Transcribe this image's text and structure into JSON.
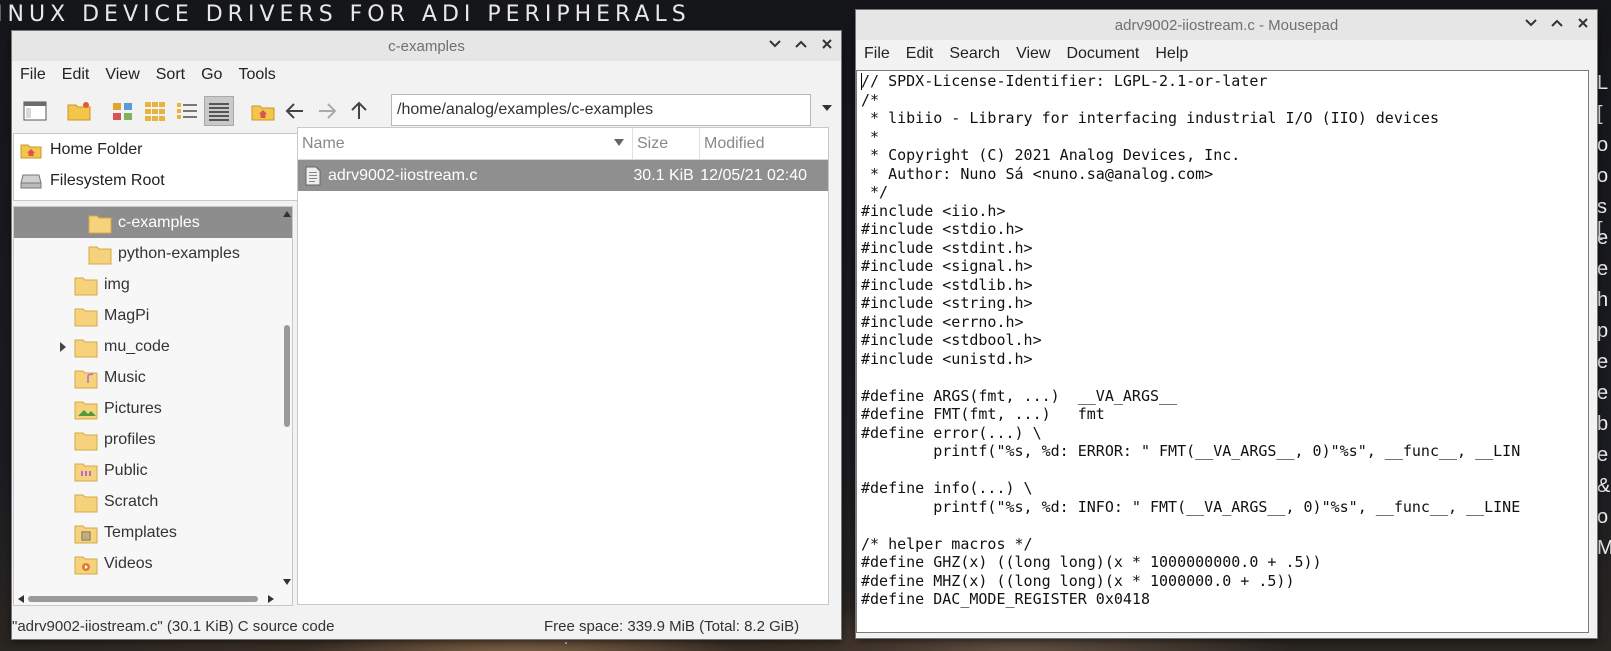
{
  "desktop": {
    "banner": "INUX DEVICE DRIVERS FOR ADI PERIPHERALS",
    "right_edge_chars": [
      "L",
      "[",
      "o",
      "o",
      "s [",
      "e",
      "e",
      "h",
      "p",
      "e",
      "e",
      "b",
      "e",
      "&",
      "o",
      "M"
    ]
  },
  "file_manager": {
    "title": "c-examples",
    "menu": [
      "File",
      "Edit",
      "View",
      "Sort",
      "Go",
      "Tools"
    ],
    "path": "/home/analog/examples/c-examples",
    "places": [
      {
        "label": "Home Folder",
        "icon": "home-icon"
      },
      {
        "label": "Filesystem Root",
        "icon": "drive-icon"
      }
    ],
    "tree": [
      {
        "label": "c-examples",
        "indent": 2,
        "selected": true,
        "icon": "folder-icon"
      },
      {
        "label": "python-examples",
        "indent": 2,
        "selected": false,
        "icon": "folder-icon"
      },
      {
        "label": "img",
        "indent": 1,
        "selected": false,
        "icon": "folder-icon"
      },
      {
        "label": "MagPi",
        "indent": 1,
        "selected": false,
        "icon": "folder-icon"
      },
      {
        "label": "mu_code",
        "indent": 1,
        "selected": false,
        "expander": true,
        "icon": "folder-icon"
      },
      {
        "label": "Music",
        "indent": 1,
        "selected": false,
        "icon": "music-folder-icon"
      },
      {
        "label": "Pictures",
        "indent": 1,
        "selected": false,
        "icon": "pictures-folder-icon"
      },
      {
        "label": "profiles",
        "indent": 1,
        "selected": false,
        "icon": "folder-icon"
      },
      {
        "label": "Public",
        "indent": 1,
        "selected": false,
        "icon": "public-folder-icon"
      },
      {
        "label": "Scratch",
        "indent": 1,
        "selected": false,
        "icon": "folder-icon"
      },
      {
        "label": "Templates",
        "indent": 1,
        "selected": false,
        "icon": "templates-folder-icon"
      },
      {
        "label": "Videos",
        "indent": 1,
        "selected": false,
        "icon": "videos-folder-icon"
      }
    ],
    "columns": {
      "name": "Name",
      "size": "Size",
      "modified": "Modified"
    },
    "files": [
      {
        "name": "adrv9002-iiostream.c",
        "size": "30.1 KiB",
        "modified": "12/05/21 02:40"
      }
    ],
    "status_left": "\"adrv9002-iiostream.c\" (30.1 KiB) C source code",
    "status_right": "Free space: 339.9 MiB (Total: 8.2 GiB)"
  },
  "mousepad": {
    "title": "adrv9002-iiostream.c - Mousepad",
    "menu": [
      "File",
      "Edit",
      "Search",
      "View",
      "Document",
      "Help"
    ],
    "lines": [
      "// SPDX-License-Identifier: LGPL-2.1-or-later",
      "/*",
      " * libiio - Library for interfacing industrial I/O (IIO) devices",
      " *",
      " * Copyright (C) 2021 Analog Devices, Inc.",
      " * Author: Nuno Sá <nuno.sa@analog.com>",
      " */",
      "#include <iio.h>",
      "#include <stdio.h>",
      "#include <stdint.h>",
      "#include <signal.h>",
      "#include <stdlib.h>",
      "#include <string.h>",
      "#include <errno.h>",
      "#include <stdbool.h>",
      "#include <unistd.h>",
      "",
      "#define ARGS(fmt, ...)  __VA_ARGS__",
      "#define FMT(fmt, ...)   fmt",
      "#define error(...) \\",
      "        printf(\"%s, %d: ERROR: \" FMT(__VA_ARGS__, 0)\"%s\", __func__, __LIN",
      "",
      "#define info(...) \\",
      "        printf(\"%s, %d: INFO: \" FMT(__VA_ARGS__, 0)\"%s\", __func__, __LINE",
      "",
      "/* helper macros */",
      "#define GHZ(x) ((long long)(x * 1000000000.0 + .5))",
      "#define MHZ(x) ((long long)(x * 1000000.0 + .5))",
      "#define DAC_MODE_REGISTER 0x0418"
    ]
  }
}
